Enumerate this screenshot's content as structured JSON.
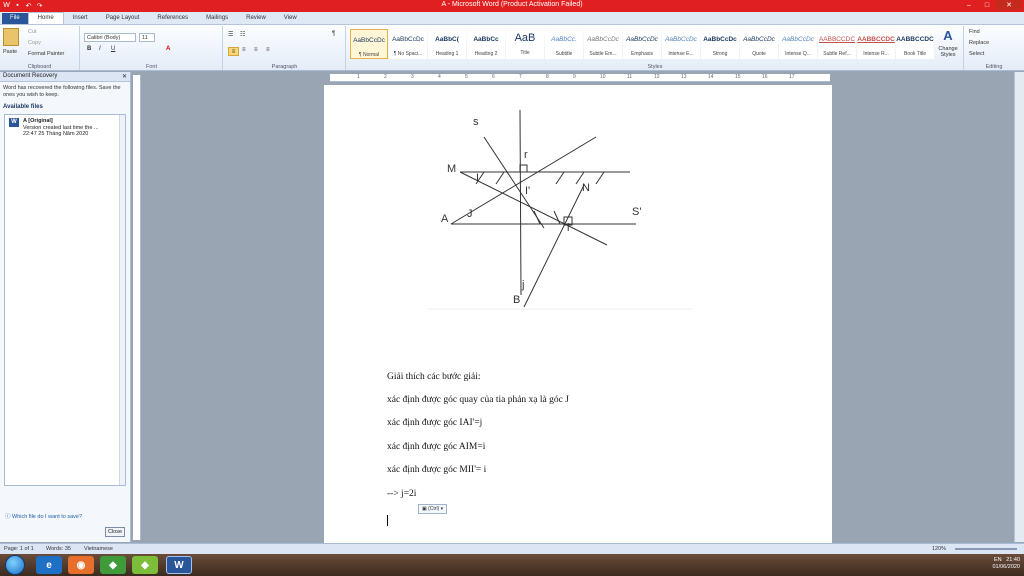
{
  "window": {
    "title": "A - Microsoft Word (Product Activation Failed)"
  },
  "tabs": [
    "File",
    "Home",
    "Insert",
    "Page Layout",
    "References",
    "Mailings",
    "Review",
    "View"
  ],
  "ribbon": {
    "clipboard": {
      "paste": "Paste",
      "cut": "Cut",
      "copy": "Copy",
      "format_painter": "Format Painter",
      "label": "Clipboard"
    },
    "font": {
      "name": "Calibri (Body)",
      "size": "11",
      "label": "Font"
    },
    "paragraph": {
      "label": "Paragraph"
    },
    "styles": {
      "label": "Styles",
      "items": [
        {
          "sample": "AaBbCcDc",
          "name": "¶ Normal"
        },
        {
          "sample": "AaBbCcDc",
          "name": "¶ No Spaci..."
        },
        {
          "sample": "AaBbC(",
          "name": "Heading 1"
        },
        {
          "sample": "AaBbCc",
          "name": "Heading 2"
        },
        {
          "sample": "AaB",
          "name": "Title"
        },
        {
          "sample": "AaBbCc.",
          "name": "Subtitle"
        },
        {
          "sample": "AaBbCcDc",
          "name": "Subtle Em..."
        },
        {
          "sample": "AaBbCcDc",
          "name": "Emphasis"
        },
        {
          "sample": "AaBbCcDc",
          "name": "Intense E..."
        },
        {
          "sample": "AaBbCcDc",
          "name": "Strong"
        },
        {
          "sample": "AaBbCcDc",
          "name": "Quote"
        },
        {
          "sample": "AaBbCcDc",
          "name": "Intense Q..."
        },
        {
          "sample": "AABBCCDC",
          "name": "Subtle Ref..."
        },
        {
          "sample": "AABBCCDC",
          "name": "Intense R..."
        },
        {
          "sample": "AABBCCDC",
          "name": "Book Title"
        }
      ],
      "change": "Change Styles"
    },
    "editing": {
      "find": "Find",
      "replace": "Replace",
      "select": "Select",
      "label": "Editing"
    }
  },
  "doc_recovery": {
    "title": "Document Recovery",
    "message": "Word has recovered the following files. Save the ones you wish to keep.",
    "available": "Available files",
    "file": {
      "name": "A [Original]",
      "desc": "Version created last time the ...",
      "time": "22:47 25 Tháng Năm 2020"
    },
    "help_link": "Which file do I want to save?",
    "close_button": "Close"
  },
  "diagram": {
    "labels": [
      "s",
      "r",
      "M",
      "I",
      "I'",
      "N",
      "S'",
      "A",
      "J",
      "i",
      "j",
      "B"
    ]
  },
  "document": {
    "lines": [
      "Giải thích các bước giải:",
      "xác định được góc quay của tia phản xạ là góc J",
      "xác định được góc IAI'=j",
      "xác định được góc AIM=i",
      "xác định được góc  MII'= i",
      "--> j=2i"
    ],
    "paste_options": "(Ctrl)"
  },
  "status": {
    "page": "Page: 1 of 1",
    "words": "Words: 35",
    "language": "Vietnamese",
    "zoom": "120%"
  },
  "tray": {
    "lang": "EN",
    "time": "21:40",
    "date": "01/06/2020"
  }
}
